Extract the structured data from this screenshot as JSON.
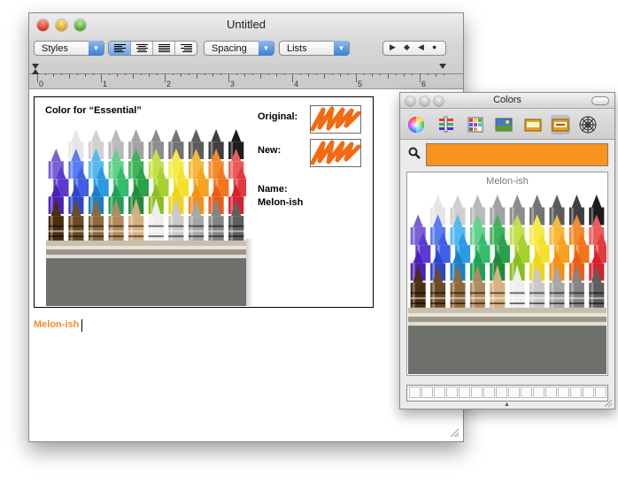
{
  "main_window": {
    "title": "Untitled",
    "toolbar": {
      "styles_label": "Styles",
      "spacing_label": "Spacing",
      "lists_label": "Lists",
      "alignment": [
        "align-left",
        "align-center",
        "justify",
        "align-right"
      ],
      "selected_alignment": "align-left"
    },
    "ruler_numbers": [
      "0",
      "1",
      "2",
      "3",
      "4",
      "5",
      "6"
    ],
    "image": {
      "heading": "Color for “Essential”",
      "original_label": "Original:",
      "new_label": "New:",
      "name_label": "Name:",
      "name_value": "Melon-ish"
    },
    "typed_text": "Melon-ish",
    "typed_text_color": "#f28c2a"
  },
  "colors_panel": {
    "title": "Colors",
    "modes": [
      "color-wheel",
      "color-sliders",
      "color-palettes",
      "image-palettes",
      "crayons"
    ],
    "selected_mode": "crayons",
    "search_icon": "magnifier-icon",
    "current_color": "#f7931e",
    "crayon_name": "Melon-ish"
  }
}
